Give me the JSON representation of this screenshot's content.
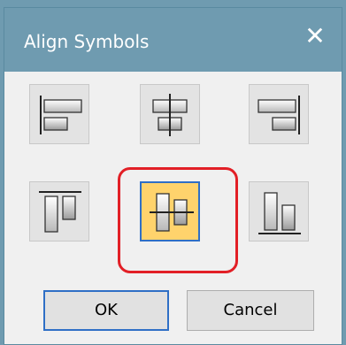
{
  "dialog": {
    "title": "Align Symbols",
    "close_glyph": "✕"
  },
  "align_options": [
    {
      "name": "align-left",
      "icon": "align-left-icon"
    },
    {
      "name": "align-center-horizontal",
      "icon": "align-center-horizontal-icon"
    },
    {
      "name": "align-right",
      "icon": "align-right-icon"
    },
    {
      "name": "align-top",
      "icon": "align-top-icon"
    },
    {
      "name": "align-middle-vertical",
      "icon": "align-middle-vertical-icon",
      "selected": true
    },
    {
      "name": "align-bottom",
      "icon": "align-bottom-icon"
    }
  ],
  "buttons": {
    "ok": "OK",
    "cancel": "Cancel"
  },
  "colors": {
    "selected_fill": "#ffd36c",
    "selected_border": "#2f6fc6",
    "highlight_ring": "#e21f26",
    "titlebar": "#6f9bb0"
  }
}
